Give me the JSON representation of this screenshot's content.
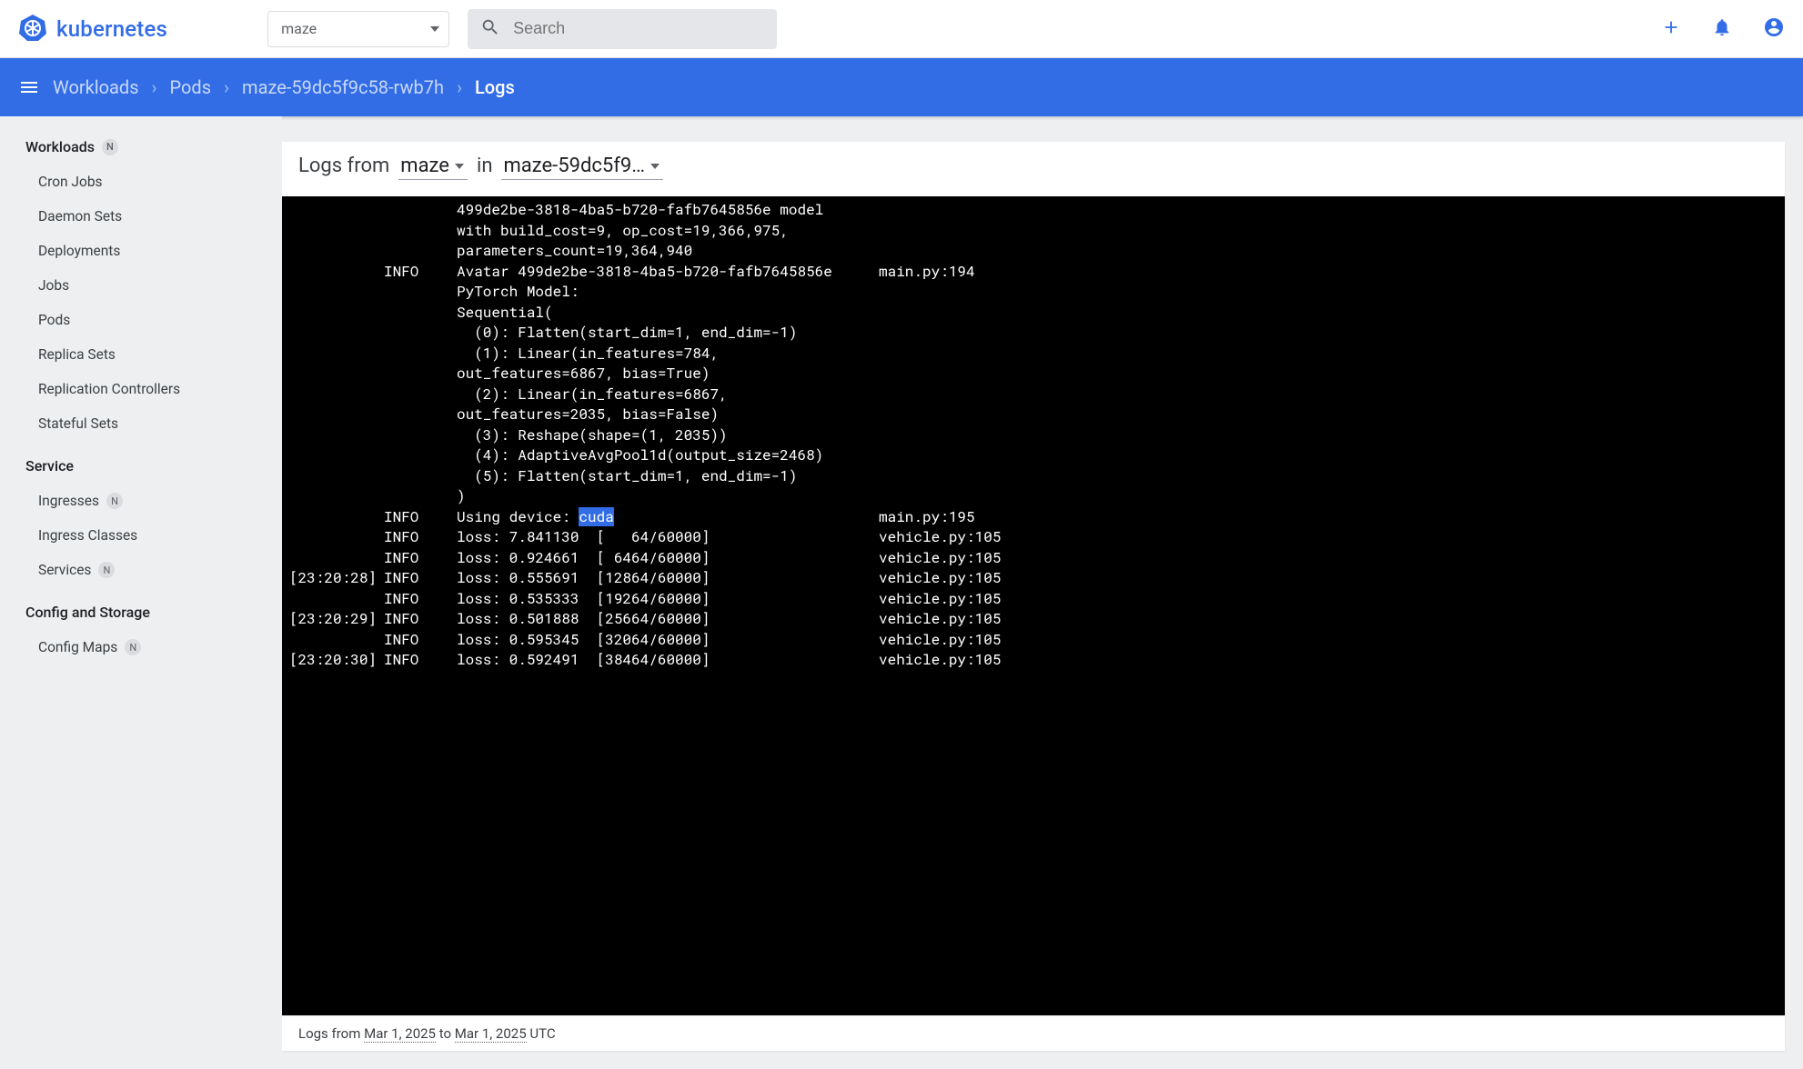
{
  "brand": "kubernetes",
  "namespace_selected": "maze",
  "search_placeholder": "Search",
  "breadcrumb": [
    "Workloads",
    "Pods",
    "maze-59dc5f9c58-rwb7h",
    "Logs"
  ],
  "sidebar": {
    "sections": [
      {
        "title": "Workloads",
        "badge": "N",
        "items": [
          "Cron Jobs",
          "Daemon Sets",
          "Deployments",
          "Jobs",
          "Pods",
          "Replica Sets",
          "Replication Controllers",
          "Stateful Sets"
        ],
        "badges": [
          "",
          "",
          "",
          "",
          "",
          "",
          "",
          ""
        ]
      },
      {
        "title": "Service",
        "badge": "",
        "items": [
          "Ingresses",
          "Ingress Classes",
          "Services"
        ],
        "badges": [
          "N",
          "",
          "N"
        ]
      },
      {
        "title": "Config and Storage",
        "badge": "",
        "items": [
          "Config Maps"
        ],
        "badges": [
          "N"
        ]
      }
    ]
  },
  "log_card": {
    "from_label": "Logs from",
    "container": "maze",
    "in_label": "in",
    "pod": "maze-59dc5f9…",
    "footer_prefix": "Logs from ",
    "footer_from": "Mar 1, 2025",
    "footer_mid": " to ",
    "footer_to": "Mar 1, 2025",
    "footer_suffix": " UTC"
  },
  "logs": [
    {
      "ts": "",
      "lvl": "",
      "msg": "499de2be-3818-4ba5-b720-fafb7645856e model with build_cost=9, op_cost=19,366,975, parameters_count=19,364,940",
      "src": ""
    },
    {
      "ts": "",
      "lvl": "INFO",
      "msg": "Avatar 499de2be-3818-4ba5-b720-fafb7645856e PyTorch Model:\nSequential(\n  (0): Flatten(start_dim=1, end_dim=-1)\n  (1): Linear(in_features=784, out_features=6867, bias=True)\n  (2): Linear(in_features=6867, out_features=2035, bias=False)\n  (3): Reshape(shape=(1, 2035))\n  (4): AdaptiveAvgPool1d(output_size=2468)\n  (5): Flatten(start_dim=1, end_dim=-1)\n)",
      "src": "main.py:194"
    },
    {
      "ts": "",
      "lvl": "INFO",
      "msg": "Using device: ",
      "msg_hl": "cuda",
      "src": "main.py:195"
    },
    {
      "ts": "",
      "lvl": "INFO",
      "msg": "loss: 7.841130  [   64/60000]",
      "src": "vehicle.py:105"
    },
    {
      "ts": "",
      "lvl": "INFO",
      "msg": "loss: 0.924661  [ 6464/60000]",
      "src": "vehicle.py:105"
    },
    {
      "ts": "[23:20:28]",
      "lvl": "INFO",
      "msg": "loss: 0.555691  [12864/60000]",
      "src": "vehicle.py:105"
    },
    {
      "ts": "",
      "lvl": "INFO",
      "msg": "loss: 0.535333  [19264/60000]",
      "src": "vehicle.py:105"
    },
    {
      "ts": "[23:20:29]",
      "lvl": "INFO",
      "msg": "loss: 0.501888  [25664/60000]",
      "src": "vehicle.py:105"
    },
    {
      "ts": "",
      "lvl": "INFO",
      "msg": "loss: 0.595345  [32064/60000]",
      "src": "vehicle.py:105"
    },
    {
      "ts": "[23:20:30]",
      "lvl": "INFO",
      "msg": "loss: 0.592491  [38464/60000]",
      "src": "vehicle.py:105"
    }
  ]
}
